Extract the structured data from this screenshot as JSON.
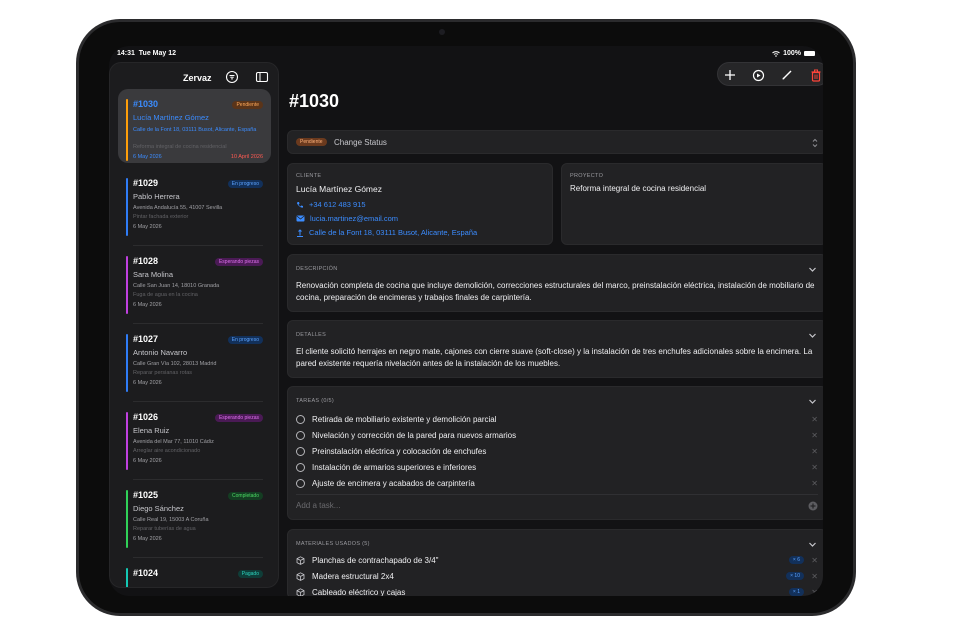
{
  "status_bar": {
    "time": "14:31",
    "date": "Tue May 12",
    "battery": "100%"
  },
  "sidebar": {
    "title": "Zervaz",
    "jobs": [
      {
        "id": "#1030",
        "badge": "Pendiente",
        "badge_color": "#ff9f43",
        "bar_color": "#ff9f0a",
        "name": "Lucía Martínez Gómez",
        "address": "Calle de la Font 18, 03111 Busot, Alicante, España",
        "task": "Reforma integral de cocina residencial",
        "date": "6 May 2026",
        "due": "10 April 2026",
        "selected": true
      },
      {
        "id": "#1029",
        "badge": "En progreso",
        "badge_color": "#3b8cff",
        "bar_color": "#2f7cf6",
        "name": "Pablo Herrera",
        "address": "Avenida Andalucía 55, 41007 Sevilla",
        "task": "Pintar fachada exterior",
        "date": "6 May 2026"
      },
      {
        "id": "#1028",
        "badge": "Esperando piezas",
        "badge_color": "#d050e0",
        "bar_color": "#c040e0",
        "name": "Sara Molina",
        "address": "Calle San Juan 14, 18010 Granada",
        "task": "Fuga de agua en la cocina",
        "date": "6 May 2026"
      },
      {
        "id": "#1027",
        "badge": "En progreso",
        "badge_color": "#3b8cff",
        "bar_color": "#2f7cf6",
        "name": "Antonio Navarro",
        "address": "Calle Gran Vía 102, 28013 Madrid",
        "task": "Reparar persianas rotas",
        "date": "6 May 2026"
      },
      {
        "id": "#1026",
        "badge": "Esperando piezas",
        "badge_color": "#d050e0",
        "bar_color": "#c040e0",
        "name": "Elena Ruiz",
        "address": "Avenida del Mar 77, 11010 Cádiz",
        "task": "Arreglar aire acondicionado",
        "date": "6 May 2026"
      },
      {
        "id": "#1025",
        "badge": "Completado",
        "badge_color": "#34c759",
        "bar_color": "#30d158",
        "name": "Diego Sánchez",
        "address": "Calle Real 19, 15003 A Coruña",
        "task": "Reparar tuberías de agua",
        "date": "6 May 2026"
      },
      {
        "id": "#1024",
        "badge": "Pagado",
        "badge_color": "#2dd4bf",
        "bar_color": "#14c8b4",
        "name": "",
        "address": "",
        "task": "",
        "date": ""
      }
    ]
  },
  "detail": {
    "title": "#1030",
    "status_badge": "Pendiente",
    "change_status_label": "Change Status",
    "client": {
      "label": "CLIENTE",
      "name": "Lucía Martínez Gómez",
      "phone": "+34 612 483 915",
      "email": "lucia.martinez@email.com",
      "address": "Calle de la Font 18, 03111 Busot, Alicante, España"
    },
    "project": {
      "label": "PROYECTO",
      "value": "Reforma integral de cocina residencial"
    },
    "description": {
      "label": "DESCRIPCIÓN",
      "text": "Renovación completa de cocina que incluye demolición, correcciones estructurales del marco, preinstalación eléctrica, instalación de mobiliario de cocina, preparación de encimeras y trabajos finales de carpintería."
    },
    "details": {
      "label": "DETALLES",
      "text": "El cliente solicitó herrajes en negro mate, cajones con cierre suave (soft-close) y la instalación de tres enchufes adicionales sobre la encimera. La pared existente requería nivelación antes de la instalación de los muebles."
    },
    "tasks": {
      "label": "TAREAS (0/5)",
      "items": [
        "Retirada de mobiliario existente y demolición parcial",
        "Nivelación y corrección de la pared para nuevos armarios",
        "Preinstalación eléctrica y colocación de enchufes",
        "Instalación de armarios superiores e inferiores",
        "Ajuste de encimera y acabados de carpintería"
      ],
      "add_placeholder": "Add a task..."
    },
    "materials": {
      "label": "MATERIALES USADOS (5)",
      "items": [
        {
          "name": "Planchas de contrachapado de 3/4\"",
          "qty": "× 6"
        },
        {
          "name": "Madera estructural 2x4",
          "qty": "× 10"
        },
        {
          "name": "Cableado eléctrico y cajas",
          "qty": "× 1"
        }
      ]
    }
  },
  "colors": {
    "accent": "#3b8cff",
    "danger": "#ff453a",
    "background": "#121214",
    "card": "#222224"
  }
}
